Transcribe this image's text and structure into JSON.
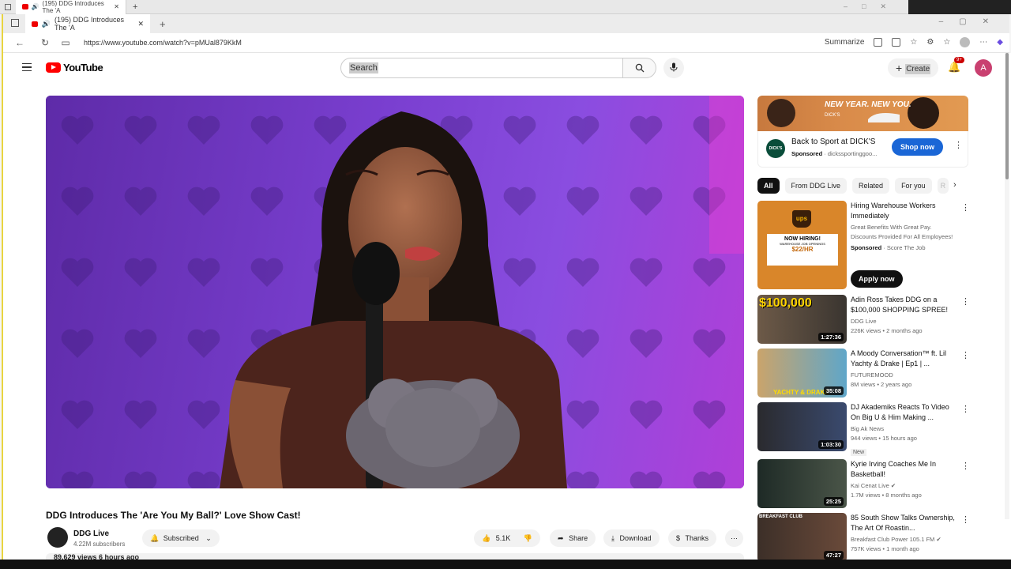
{
  "outer_tab": {
    "title": "(195) DDG Introduces The 'A"
  },
  "browser": {
    "tab_title": "(195) DDG Introduces The 'A",
    "url": "https://www.youtube.com/watch?v=pMUal879KkM",
    "summarize_label": "Summarize"
  },
  "masthead": {
    "logo_text": "YouTube",
    "search_placeholder": "Search",
    "create_label": "Create",
    "notification_count": "9+",
    "avatar_letter": "A"
  },
  "video": {
    "title": "DDG Introduces The 'Are You My Ball?' Love Show Cast!",
    "channel_name": "DDG Live",
    "subscribers": "4.22M subscribers",
    "subscribed_label": "Subscribed",
    "likes": "5.1K",
    "share_label": "Share",
    "download_label": "Download",
    "thanks_label": "Thanks",
    "views_date": "89,629 views  6 hours ago"
  },
  "ad": {
    "banner_text": "NEW YEAR. NEW YOU.",
    "banner_brand": "DICK'S",
    "logo_text": "DICK'S",
    "title": "Back to Sport at DICK'S",
    "sponsored": "Sponsored",
    "domain": "dickssportinggoo...",
    "button": "Shop now"
  },
  "chips": [
    "All",
    "From DDG Live",
    "Related",
    "For you",
    "R"
  ],
  "recommendations": [
    {
      "title": "Hiring Warehouse Workers Immediately",
      "desc": "Great Benefits With Great Pay. Discounts Provided For All Employees!",
      "sponsored": "Sponsored",
      "advertiser": "Score The Job",
      "button": "Apply now",
      "thumb_logo": "ups",
      "thumb_line1": "NOW HIRING!",
      "thumb_line2": "WAREHOUSE JOB OPENINGS",
      "thumb_line3": "$22/HR"
    },
    {
      "title": "Adin Ross Takes DDG on a $100,000 SHOPPING SPREE!",
      "channel": "DDG Live",
      "stats": "226K views • 2 months ago",
      "duration": "1:27:36",
      "thumb_text": "$100,000"
    },
    {
      "title": "A Moody Conversation™ ft. Lil Yachty & Drake | Ep1 | ...",
      "channel": "FUTUREMOOD",
      "stats": "8M views • 2 years ago",
      "duration": "35:08",
      "thumb_text": "YACHTY & DRAKE"
    },
    {
      "title": "DJ Akademiks Reacts To Video On Big U & Him Making ...",
      "channel": "Big Ak News",
      "stats": "944 views • 15 hours ago",
      "duration": "1:03:30",
      "badge": "New"
    },
    {
      "title": "Kyrie Irving Coaches Me In Basketball!",
      "channel": "Kai Cenat Live",
      "stats": "1.7M views • 8 months ago",
      "duration": "25:25"
    },
    {
      "title": "85 South Show Talks Ownership, The Art Of Roastin...",
      "channel": "Breakfast Club Power 105.1 FM",
      "stats": "757K views • 1 month ago",
      "duration": "47:27",
      "thumb_text": "BREAKFAST CLUB"
    }
  ],
  "colors": {
    "brand_red": "#ff0000",
    "shop_blue": "#1a66d6",
    "player_purple": "#7a3fd0"
  }
}
